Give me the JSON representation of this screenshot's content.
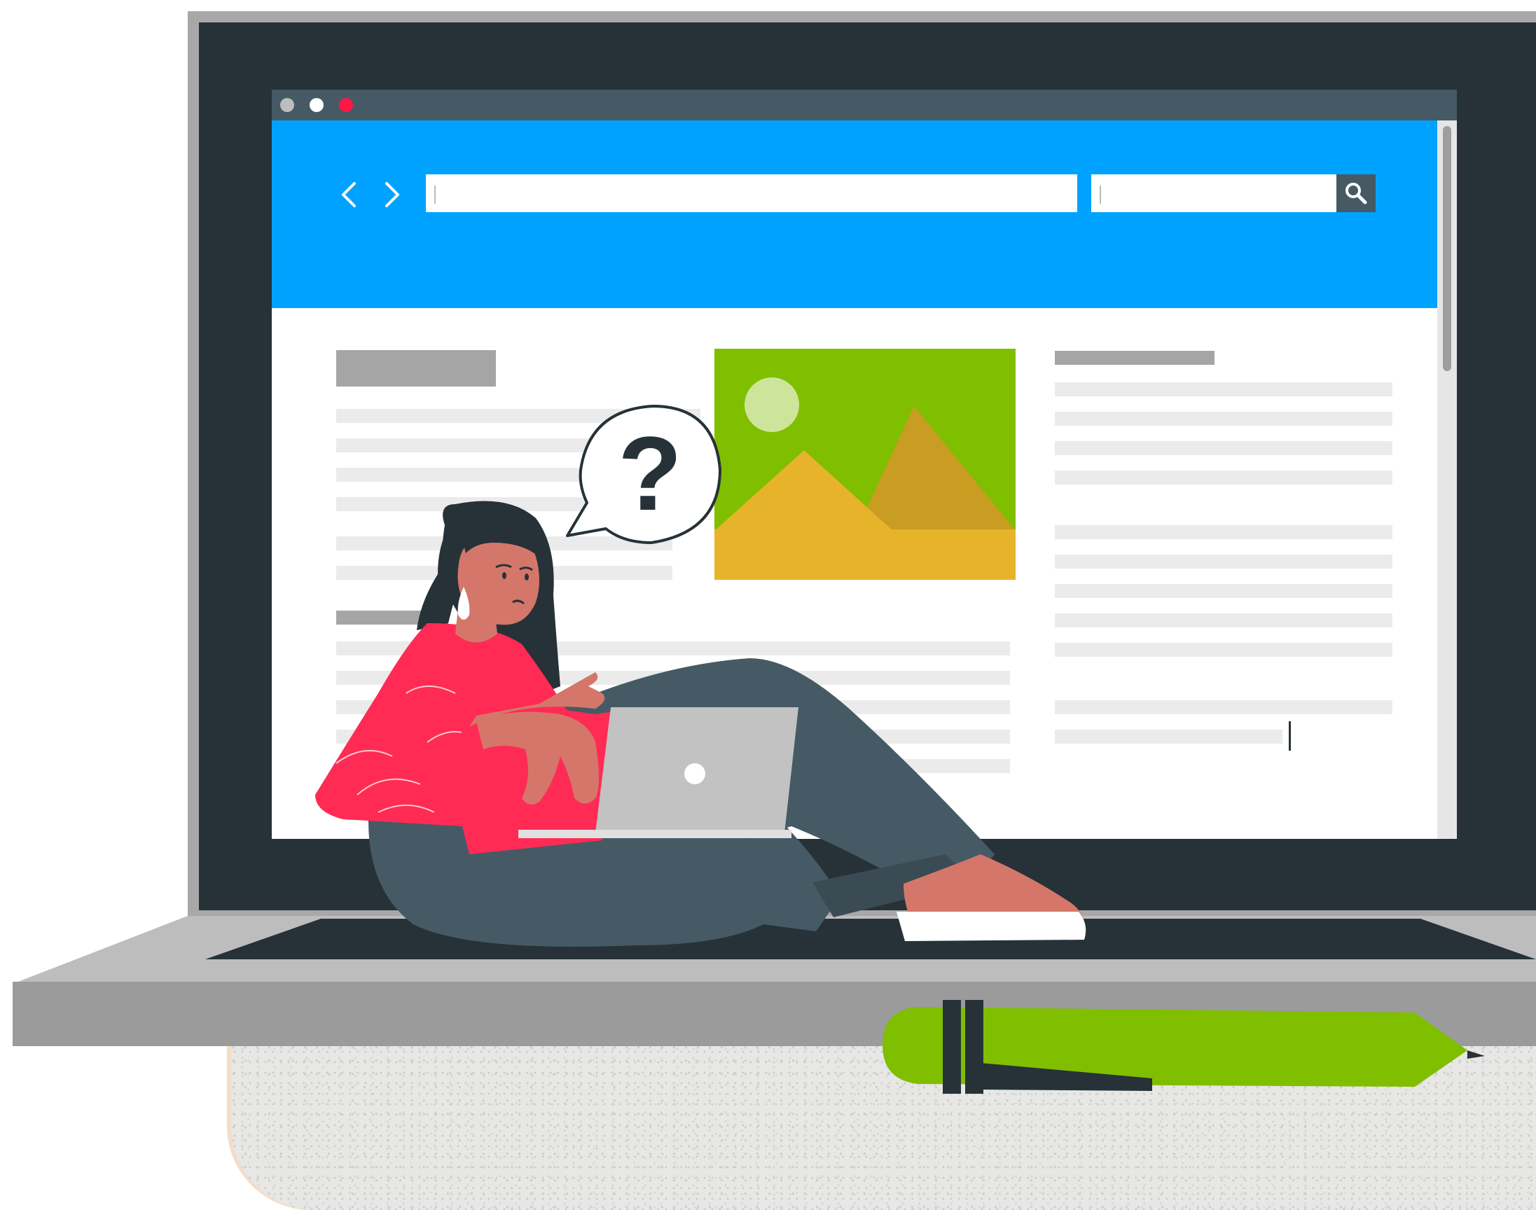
{
  "colors": {
    "bezel": "#263238",
    "bezel_rim": "#a8a8a8",
    "titlebar": "#455a64",
    "toolbar": "#00a2ff",
    "heading_bar": "#a5a5a5",
    "text_line": "#ebebeb",
    "image_bg": "#80be00",
    "image_mountain": "#e6b32a",
    "image_sun": "#cde59a",
    "sweater": "#ff2b55",
    "pants": "#455a64",
    "skin": "#d4776a",
    "pen": "#80be00",
    "window_dot_close": "#ff1744"
  },
  "browser": {
    "window_dots": [
      "grey",
      "white",
      "red"
    ],
    "nav": {
      "back_icon": "chevron-left-icon",
      "forward_icon": "chevron-right-icon"
    },
    "address_bar": {
      "value": "",
      "placeholder": ""
    },
    "search": {
      "value": "",
      "placeholder": "",
      "icon": "search-icon"
    }
  },
  "content": {
    "image_icon": "image-placeholder-icon",
    "speech_bubble_text": "?"
  },
  "illustration": {
    "figure": "woman-with-laptop",
    "laptop_logo_icon": "circle-logo-icon",
    "props": [
      "pen"
    ]
  }
}
